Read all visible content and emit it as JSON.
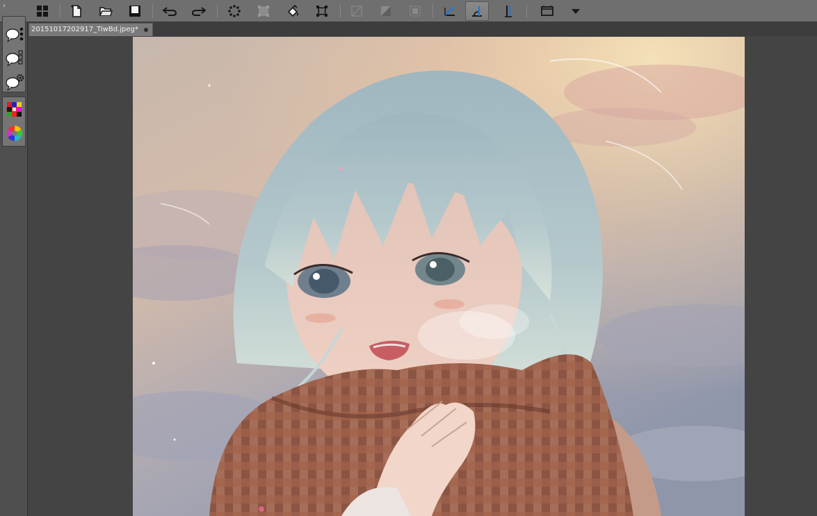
{
  "toolbar": {
    "buttons": [
      {
        "name": "grid-view-icon",
        "active": false
      },
      {
        "name": "new-document-icon",
        "active": false
      },
      {
        "name": "open-folder-icon",
        "active": false
      },
      {
        "name": "save-icon",
        "active": false
      },
      {
        "name": "undo-icon",
        "active": false
      },
      {
        "name": "redo-icon",
        "active": false
      },
      {
        "name": "marching-select-icon",
        "active": false
      },
      {
        "name": "transform-box-icon",
        "active": false
      },
      {
        "name": "fill-bucket-icon",
        "active": false
      },
      {
        "name": "free-transform-icon",
        "active": false
      },
      {
        "name": "crop-diagonal-icon",
        "active": false
      },
      {
        "name": "gradient-square-icon",
        "active": false
      },
      {
        "name": "selection-square-icon",
        "active": false
      },
      {
        "name": "angle-ruler-icon",
        "active": false
      },
      {
        "name": "ruler-snap-icon",
        "active": true
      },
      {
        "name": "vertical-ruler-icon",
        "active": false
      },
      {
        "name": "screen-capture-icon",
        "active": false
      },
      {
        "name": "dropdown-arrow-icon",
        "active": false
      }
    ]
  },
  "left_panel": {
    "groups": [
      {
        "items": [
          "speech-bubble-dots-icon",
          "speech-bubble-grid-icon",
          "speech-bubble-gear-icon"
        ]
      },
      {
        "items": [
          "color-palette-icon",
          "color-wheel-icon"
        ]
      }
    ]
  },
  "document": {
    "tab_title": "20151017202917_TiwBd.jpeg*"
  },
  "colors": {
    "toolbar_bg": "#6f6f6f",
    "workspace_bg": "#444444",
    "active_accent": "#1e7ad8"
  }
}
